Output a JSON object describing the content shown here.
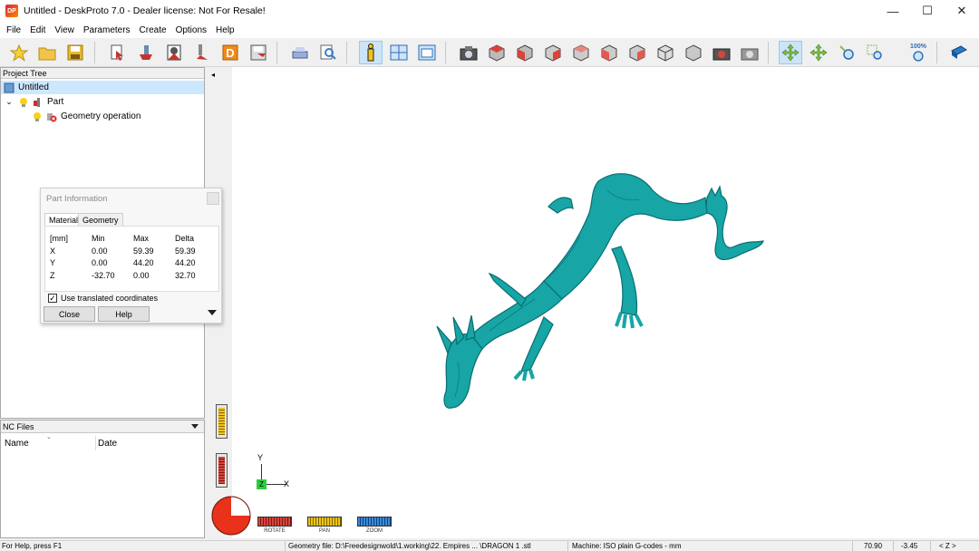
{
  "window": {
    "icon_text": "DP",
    "title": "Untitled - DeskProto 7.0 - Dealer license: Not For Resale!",
    "minimize": "—",
    "maximize": "☐",
    "close": "✕"
  },
  "menu": [
    "File",
    "Edit",
    "View",
    "Parameters",
    "Create",
    "Options",
    "Help"
  ],
  "toolbar": {
    "zoom_percent_label": "100%"
  },
  "project_tree": {
    "header": "Project Tree",
    "root": "Untitled",
    "part": "Part",
    "operation": "Geometry operation",
    "expander": "⌄"
  },
  "nc_files": {
    "header": "NC Files",
    "columns": [
      "Name",
      "Date"
    ]
  },
  "part_info": {
    "title": "Part Information",
    "tabs": [
      "Material",
      "Geometry"
    ],
    "headers": [
      "[mm]",
      "Min",
      "Max",
      "Delta"
    ],
    "rows": [
      [
        "X",
        "0.00",
        "59.39",
        "59.39"
      ],
      [
        "Y",
        "0.00",
        "44.20",
        "44.20"
      ],
      [
        "Z",
        "-32.70",
        "0.00",
        "32.70"
      ]
    ],
    "checkbox_label": "Use translated coordinates",
    "checkbox_checked": "✓",
    "close_label": "Close",
    "help_label": "Help"
  },
  "viewport": {
    "collapse_arrow": "◂",
    "axis_y": "Y",
    "axis_x": "X",
    "axis_z": "Z",
    "model_color": "#17a5a6"
  },
  "mouse_modes": {
    "rotate": "ROTATE",
    "pan": "PAN",
    "zoom": "ZOOM"
  },
  "status": {
    "help": "For Help, press F1",
    "geometry_file": "Geometry file: D:\\Freedesignwold\\1.working\\22. Empires ... \\DRAGON 1 .stl",
    "machine": "Machine: ISO plain G-codes - mm",
    "x": "70.90",
    "y": "-3.45",
    "z": "< Z >"
  }
}
